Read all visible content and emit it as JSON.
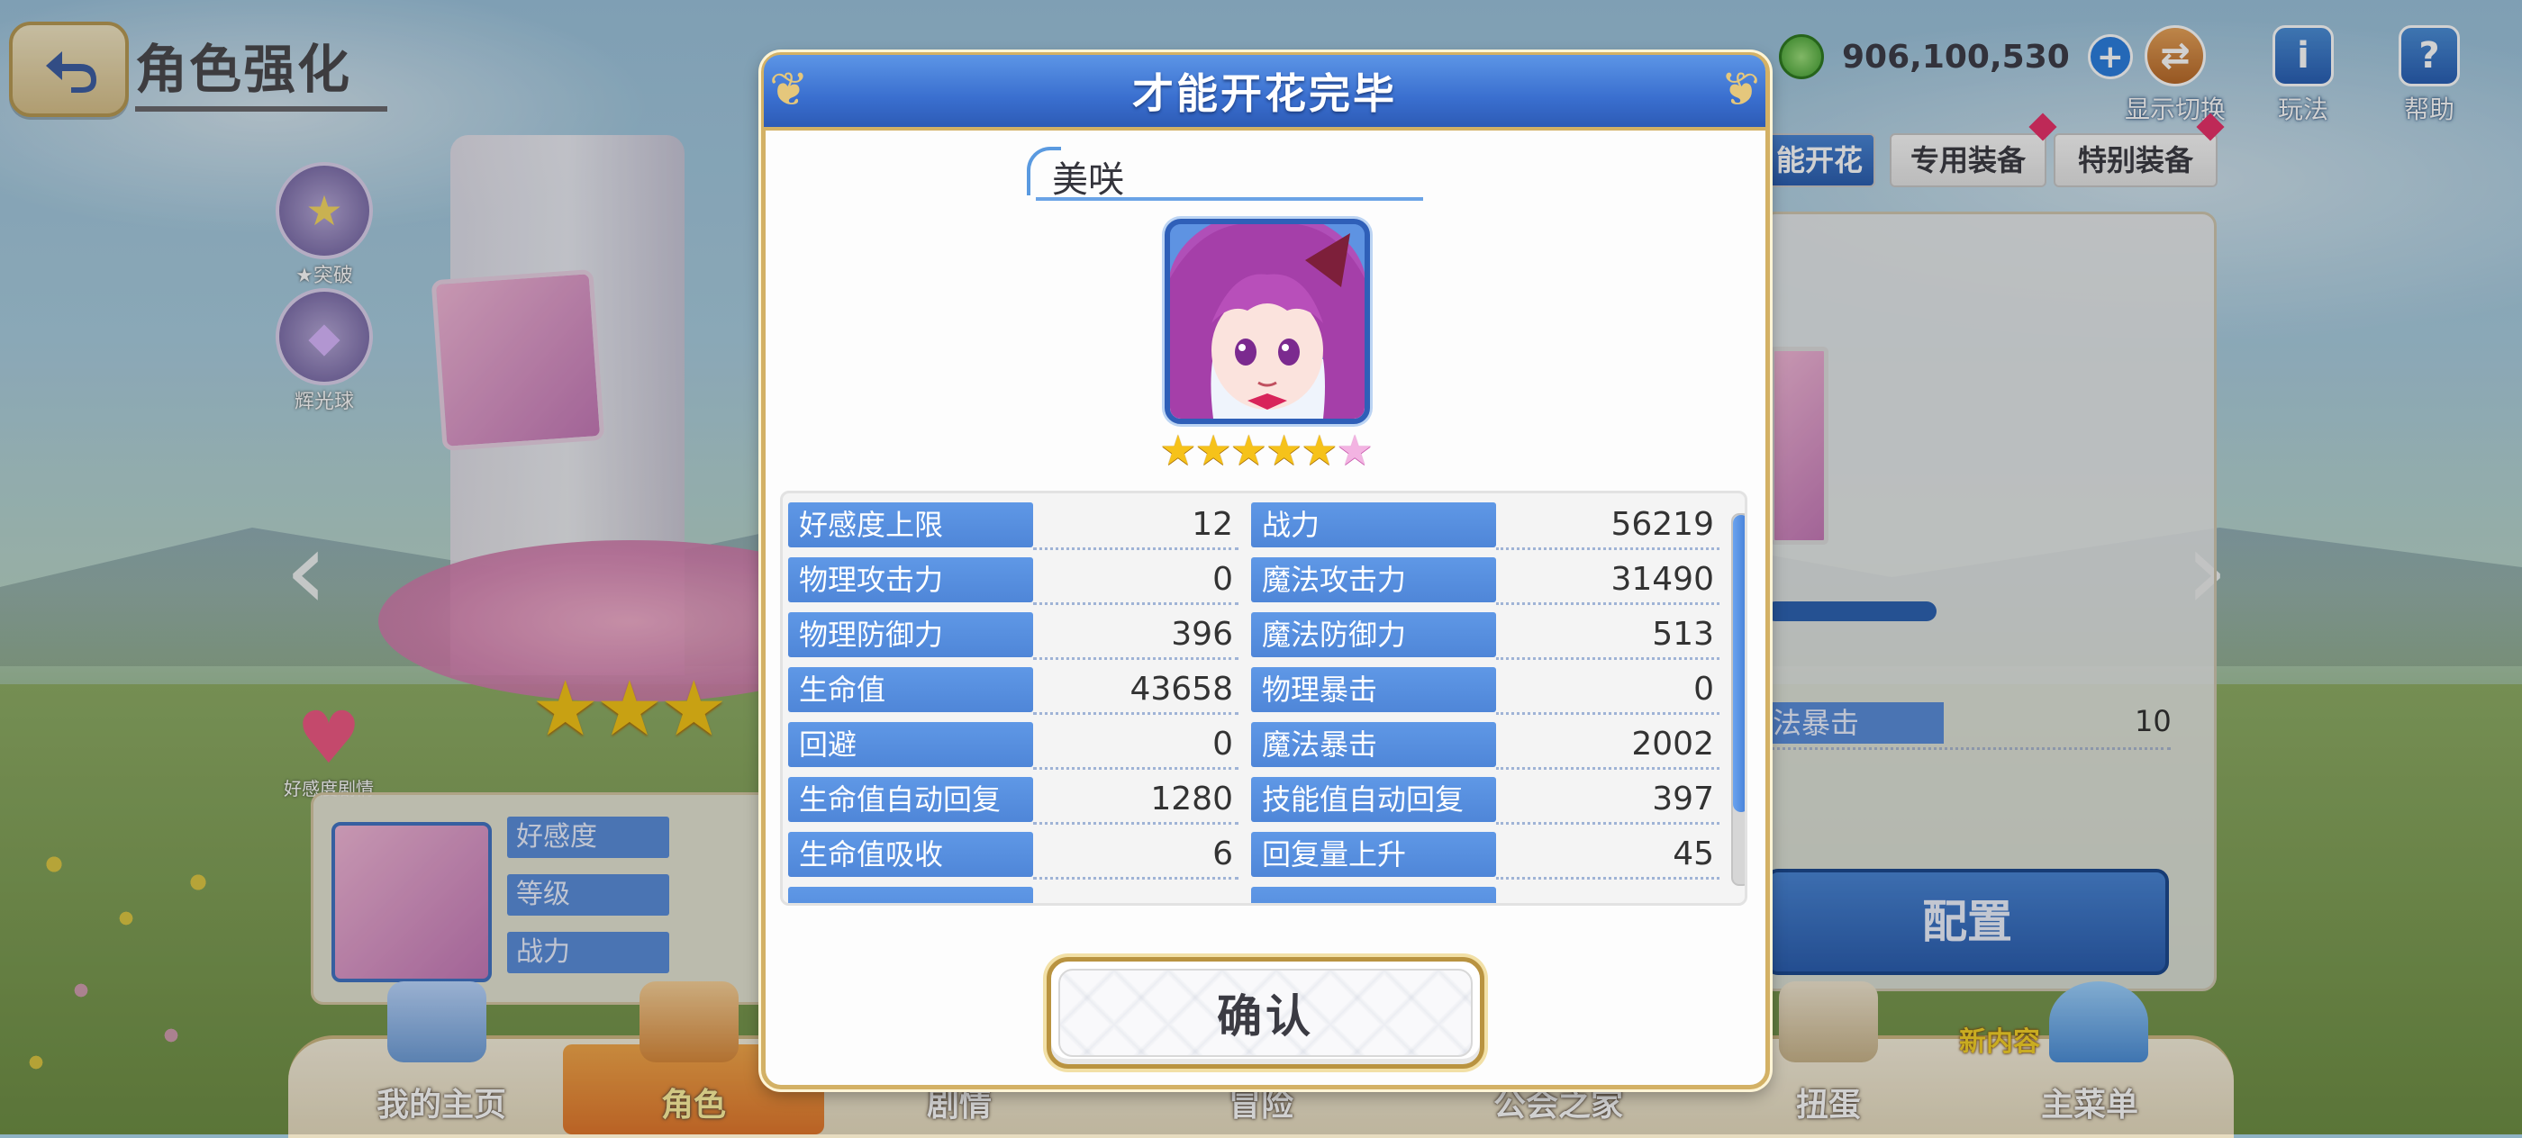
{
  "header": {
    "title": "角色强化"
  },
  "top_right": {
    "currency_value": "906,100,530",
    "tools": [
      {
        "label": "显示切换",
        "icon": "display-switch-icon"
      },
      {
        "label": "玩法",
        "icon": "info-icon"
      },
      {
        "label": "帮助",
        "icon": "help-icon"
      }
    ]
  },
  "left_side": {
    "buttons": [
      {
        "label": "★突破"
      },
      {
        "label": "辉光球"
      }
    ],
    "heart_label": "好感度剧情"
  },
  "info_panel": {
    "rows": [
      "好感度",
      "等级",
      "战力"
    ]
  },
  "right_panel": {
    "tabs": [
      "能开花",
      "专用装备",
      "特别装备"
    ],
    "stat_label": "法暴击",
    "stat_value": "10",
    "config_button": "配置"
  },
  "bottom_nav": {
    "items": [
      "我的主页",
      "角色",
      "剧情",
      "冒险",
      "公会之家",
      "扭蛋",
      "主菜单"
    ],
    "active_index": 1,
    "new_tag": "新内容"
  },
  "dialog": {
    "title": "才能开花完毕",
    "character_name": "美咲",
    "stars": {
      "gold": 5,
      "pink": 1
    },
    "stats_left": [
      {
        "label": "好感度上限",
        "value": "12"
      },
      {
        "label": "物理攻击力",
        "value": "0"
      },
      {
        "label": "物理防御力",
        "value": "396"
      },
      {
        "label": "生命值",
        "value": "43658"
      },
      {
        "label": "回避",
        "value": "0"
      },
      {
        "label": "生命值自动回复",
        "value": "1280"
      },
      {
        "label": "生命值吸收",
        "value": "6"
      }
    ],
    "stats_right": [
      {
        "label": "战力",
        "value": "56219"
      },
      {
        "label": "魔法攻击力",
        "value": "31490"
      },
      {
        "label": "魔法防御力",
        "value": "513"
      },
      {
        "label": "物理暴击",
        "value": "0"
      },
      {
        "label": "魔法暴击",
        "value": "2002"
      },
      {
        "label": "技能值自动回复",
        "value": "397"
      },
      {
        "label": "回复量上升",
        "value": "45"
      }
    ],
    "confirm_label": "确认"
  },
  "colors": {
    "accent_blue": "#3a6fcf",
    "gold_border": "#d3b165",
    "stat_label_bg": "#5f98e6"
  }
}
